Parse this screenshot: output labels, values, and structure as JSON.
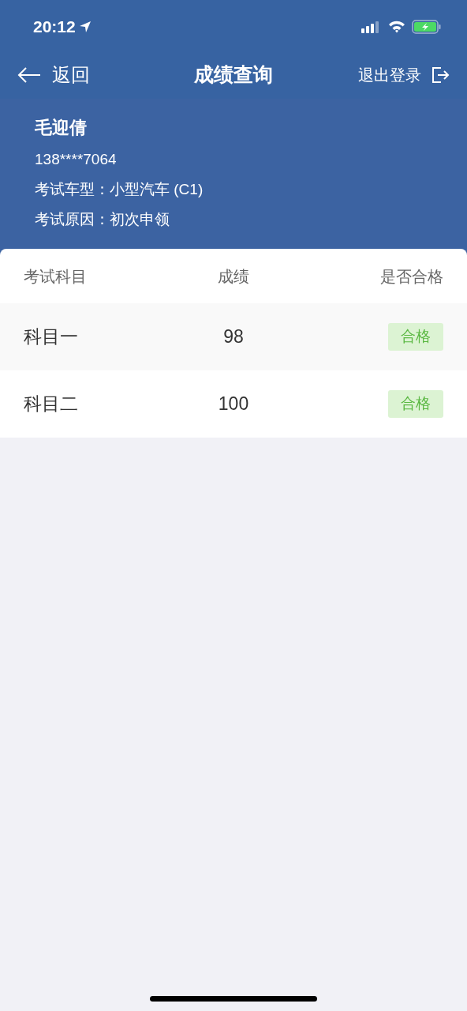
{
  "status_bar": {
    "time": "20:12"
  },
  "nav": {
    "back": "返回",
    "title": "成绩查询",
    "logout": "退出登录"
  },
  "profile": {
    "name": "毛迎倩",
    "phone": "138****7064",
    "fields": [
      {
        "label": "考试车型：",
        "value": "小型汽车 (C1)"
      },
      {
        "label": "考试原因：",
        "value": "初次申领"
      }
    ]
  },
  "table": {
    "columns": [
      "考试科目",
      "成绩",
      "是否合格"
    ],
    "rows": [
      {
        "subject": "科目一",
        "score": "98",
        "result": "合格",
        "passed": true
      },
      {
        "subject": "科目二",
        "score": "100",
        "result": "合格",
        "passed": true
      }
    ]
  }
}
